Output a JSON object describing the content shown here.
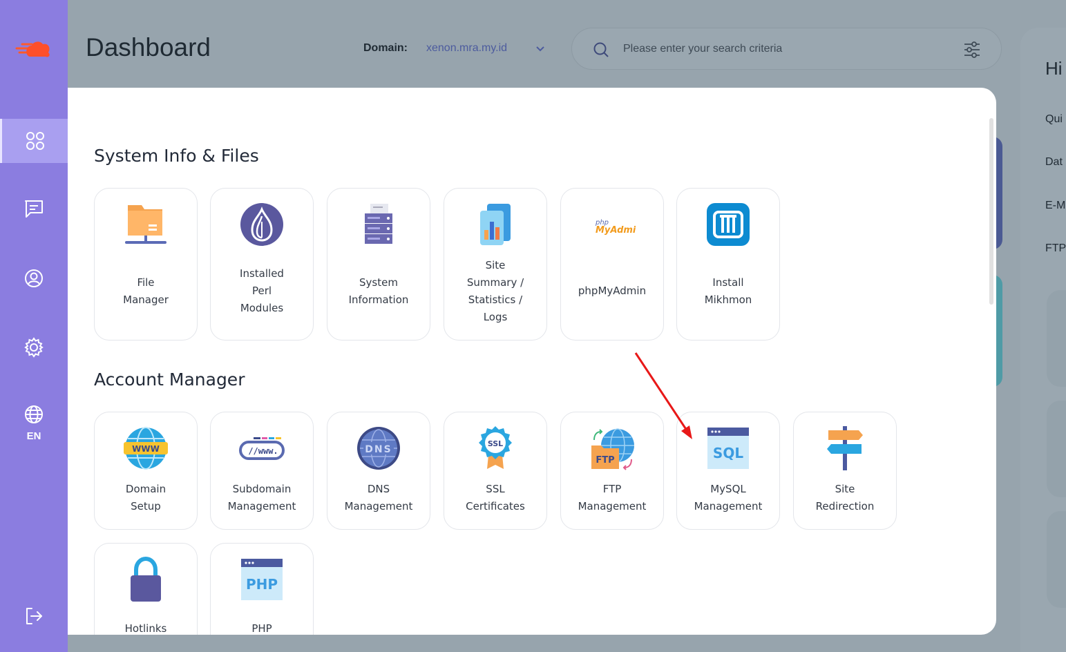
{
  "header": {
    "title": "Dashboard",
    "domain_label": "Domain:",
    "domain_value": "xenon.mra.my.id",
    "search_placeholder": "Please enter your search criteria"
  },
  "sidebar": {
    "items": [
      {
        "icon": "grid-icon",
        "active": true
      },
      {
        "icon": "chat-icon"
      },
      {
        "icon": "user-circle-icon"
      },
      {
        "icon": "gear-icon"
      },
      {
        "icon": "globe-icon",
        "label": "EN"
      },
      {
        "icon": "logout-icon"
      }
    ]
  },
  "right_panel": {
    "greeting": "Hi",
    "rows": [
      "Qui",
      "Dat",
      "E-M",
      "FTP"
    ]
  },
  "sections": [
    {
      "title": "System Info & Files",
      "tiles": [
        {
          "label": "File\nManager",
          "icon": "folder-network-icon"
        },
        {
          "label": "Installed\nPerl\nModules",
          "icon": "perl-onion-icon"
        },
        {
          "label": "System\nInformation",
          "icon": "server-icon"
        },
        {
          "label": "Site\nSummary /\nStatistics /\nLogs",
          "icon": "statistics-chart-icon"
        },
        {
          "label": "phpMyAdmin",
          "icon": "phpmyadmin-logo-icon",
          "logo_small": "php",
          "logo_big": "MyAdmin"
        },
        {
          "label": "Install\nMikhmon",
          "icon": "mikhmon-logo-icon"
        }
      ]
    },
    {
      "title": "Account Manager",
      "tiles": [
        {
          "label": "Domain\nSetup",
          "icon": "www-globe-icon",
          "badge": "WWW"
        },
        {
          "label": "Subdomain\nManagement",
          "icon": "subdomain-bar-icon",
          "badge": "//www."
        },
        {
          "label": "DNS\nManagement",
          "icon": "dns-globe-icon",
          "badge": "DNS"
        },
        {
          "label": "SSL\nCertificates",
          "icon": "ssl-badge-icon",
          "badge": "SSL"
        },
        {
          "label": "FTP\nManagement",
          "icon": "ftp-folder-icon",
          "badge": "FTP"
        },
        {
          "label": "MySQL\nManagement",
          "icon": "sql-window-icon",
          "badge": "SQL"
        },
        {
          "label": "Site\nRedirection",
          "icon": "signpost-icon"
        },
        {
          "label": "Hotlinks",
          "icon": "padlock-icon"
        },
        {
          "label": "PHP",
          "icon": "php-window-icon",
          "badge": "PHP"
        }
      ]
    }
  ],
  "colors": {
    "sidebar": "#8b7de0",
    "overlay_backdrop": "#97a4ad",
    "annotation_arrow": "#e81818"
  }
}
